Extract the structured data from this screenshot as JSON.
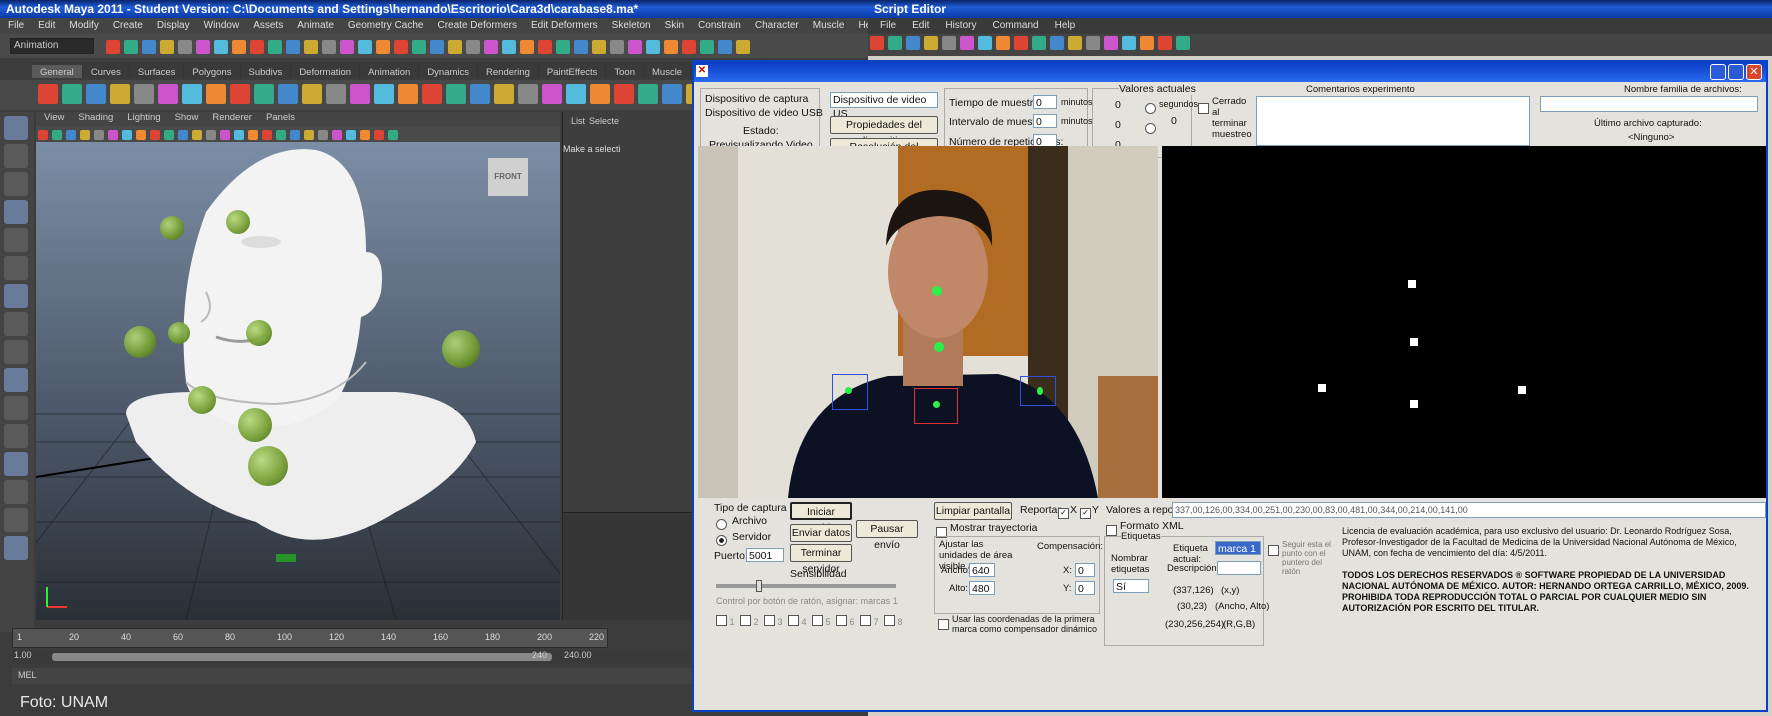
{
  "maya": {
    "title": "Autodesk Maya 2011 - Student Version: C:\\Documents and Settings\\hernando\\Escritorio\\Cara3d\\carabase8.ma*",
    "menu": [
      "File",
      "Edit",
      "Modify",
      "Create",
      "Display",
      "Window",
      "Assets",
      "Animate",
      "Geometry Cache",
      "Create Deformers",
      "Edit Deformers",
      "Skeleton",
      "Skin",
      "Constrain",
      "Character",
      "Muscle",
      "Help"
    ],
    "mode_dropdown": "Animation",
    "shelf_tabs": [
      "General",
      "Curves",
      "Surfaces",
      "Polygons",
      "Subdivs",
      "Deformation",
      "Animation",
      "Dynamics",
      "Rendering",
      "PaintEffects",
      "Toon",
      "Muscle"
    ],
    "panel_menu": [
      "View",
      "Shading",
      "Lighting",
      "Show",
      "Renderer",
      "Panels"
    ],
    "viewcube_label": "FRONT",
    "right_panel": {
      "tabs": [
        "List",
        "Selecte"
      ],
      "hint": "Make a selecti"
    },
    "timeline_ticks": [
      "1",
      "20",
      "40",
      "60",
      "80",
      "100",
      "120",
      "140",
      "160",
      "180",
      "200",
      "220"
    ],
    "range_start": "1.00",
    "range_end": "240",
    "range_end2": "240.00",
    "cmd_label": "MEL",
    "watermark": "Foto: UNAM",
    "colors": {
      "titlebar": "#1f5bd6",
      "sphere": "#8fbf3f"
    }
  },
  "script_editor": {
    "title": "Script Editor",
    "menu": [
      "File",
      "Edit",
      "History",
      "Command",
      "Help"
    ]
  },
  "app": {
    "capture": {
      "device_label": "Dispositivo de captura",
      "device_label2": "Dispositivo de video USB",
      "state_label": "Estado:",
      "state_value": "Previsualizando Video",
      "device_select": "Dispositivo de video US",
      "props_btn": "Propiedades del dispositivo",
      "res_btn": "Resolución del dispositivo"
    },
    "timing": {
      "sample_time_label": "Tiempo de muestreo:",
      "sample_time_value": "0",
      "sample_time_unit": "minutos",
      "interval_label": "Intervalo de muestreo:",
      "interval_value": "0",
      "interval_unit": "minutos",
      "reps_label": "Número de repeticiones:",
      "reps_value": "0"
    },
    "remaining": {
      "header": "Valores actuales",
      "v1": "0",
      "v2": "0",
      "v3": "0",
      "v4": "0",
      "seconds_label": "segundos"
    },
    "end_sample_label": "Cerrado al terminar muestreo",
    "comments_label": "Comentarios experimento",
    "filename_label": "Nombre familia de archivos:",
    "last_file_label": "Último archivo capturado:",
    "last_file_value": "<Ninguno>",
    "capture_type": {
      "title": "Tipo de captura",
      "opt_file": "Archivo",
      "opt_server": "Servidor",
      "port_label": "Puerto:",
      "port_value": "5001"
    },
    "server_btns": {
      "start": "Iniciar servidor",
      "send": "Enviar datos",
      "pause": "Pausar envío",
      "stop": "Terminar servidor"
    },
    "sensitivity_label": "Sensibilidad",
    "clear_btn": "Limpiar pantalla",
    "report_label": "Reportar",
    "x_label": "X",
    "y_label": "Y",
    "values_label": "Valores a reportar",
    "values_field": "337,00,126,00,334,00,251,00,230,00,83,00,481,00,344,00,214,00,141,00",
    "xml_label": "Formato XML",
    "show_traj_label": "Mostrar trayectoria",
    "adjust_label": "Ajustar las unidades de área visible a",
    "width_label": "Ancho:",
    "width_value": "640",
    "height_label": "Alto:",
    "height_value": "480",
    "comp_label": "Compensación:",
    "comp_x_label": "X:",
    "comp_x_value": "0",
    "comp_y_label": "Y:",
    "comp_y_value": "0",
    "use_first_label": "Usar las coordenadas de la primera marca como compensador dinámico",
    "labels_group": "Etiquetas",
    "name_labels_label": "Nombrar etiquetas",
    "name_labels_value": "Sí",
    "tag_label": "Etiqueta actual:",
    "tag_value": "marca 1",
    "desc_label": "Descripción:",
    "coord_1": "(337,126)",
    "coord_1_desc": "(x,y)",
    "coord_2": "(30,23)",
    "coord_2_desc": "(Ancho, Alto)",
    "coord_3": "(230,256,254)",
    "coord_3_desc": "(R,G,B)",
    "follow_label": "Seguir esta el punto con el puntero del ratón",
    "license_text": "Licencia de evaluación académica, para uso exclusivo del usuario: Dr. Leonardo Rodríguez Sosa, Profesor-Investigador de la Facultad de Medicina de la Universidad Nacional Autónoma de México, UNAM, con fecha de vencimiento del día: 4/5/2011.",
    "rights_text": "TODOS LOS DERECHOS RESERVADOS ® SOFTWARE PROPIEDAD DE LA UNIVERSIDAD NACIONAL AUTÓNOMA DE MÉXICO. AUTOR: HERNANDO ORTEGA CARRILLO, MÉXICO, 2009. PROHIBIDA TODA REPRODUCCIÓN TOTAL O PARCIAL POR CUALQUIER MEDIO SIN AUTORIZACIÓN POR ESCRITO DEL TITULAR.",
    "marker_checks": [
      "1",
      "2",
      "3",
      "4",
      "5",
      "6",
      "7",
      "8"
    ],
    "marker_row_label": "Control por botón de ratón, asignar: marcas 1"
  }
}
